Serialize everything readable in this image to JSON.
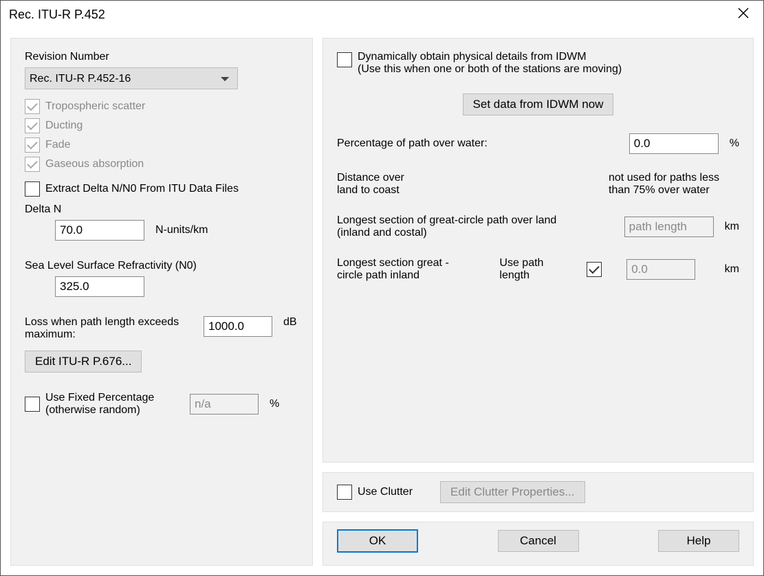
{
  "window": {
    "title": "Rec. ITU-R P.452"
  },
  "left": {
    "revision_label": "Revision Number",
    "revision_value": "Rec. ITU-R P.452-16",
    "checks": {
      "tropo": "Tropospheric scatter",
      "ducting": "Ducting",
      "fade": "Fade",
      "gaseous": "Gaseous absorption"
    },
    "extract_label": "Extract Delta N/N0 From ITU Data Files",
    "delta_n_label": "Delta N",
    "delta_n_value": "70.0",
    "delta_n_unit": "N-units/km",
    "n0_label": "Sea Level Surface Refractivity (N0)",
    "n0_value": "325.0",
    "loss_label": "Loss when path length exceeds maximum:",
    "loss_value": "1000.0",
    "loss_unit": "dB",
    "edit_p676": "Edit ITU-R P.676...",
    "fixed_pct_label": "Use Fixed Percentage\n(otherwise random)",
    "fixed_pct_placeholder": "n/a",
    "fixed_pct_unit": "%"
  },
  "right": {
    "dyn_label": "Dynamically obtain physical details from IDWM",
    "dyn_sub": "(Use this when one or both of the stations are moving)",
    "set_idwm_btn": "Set data from IDWM now",
    "pct_water_label": "Percentage of path over water:",
    "pct_water_value": "0.0",
    "pct_water_unit": "%",
    "dist_coast_label": "Distance over\nland to coast",
    "dist_coast_note": "not used for paths less than 75% over water",
    "longest_over_land_label": "Longest section of great-circle path over land (inland and costal)",
    "longest_over_land_placeholder": "path length",
    "km": "km",
    "longest_inland_label": "Longest section great -circle path inland",
    "use_path_len_label": "Use path length",
    "longest_inland_value": "0.0",
    "use_clutter_label": "Use Clutter",
    "edit_clutter_btn": "Edit Clutter Properties..."
  },
  "buttons": {
    "ok": "OK",
    "cancel": "Cancel",
    "help": "Help"
  }
}
